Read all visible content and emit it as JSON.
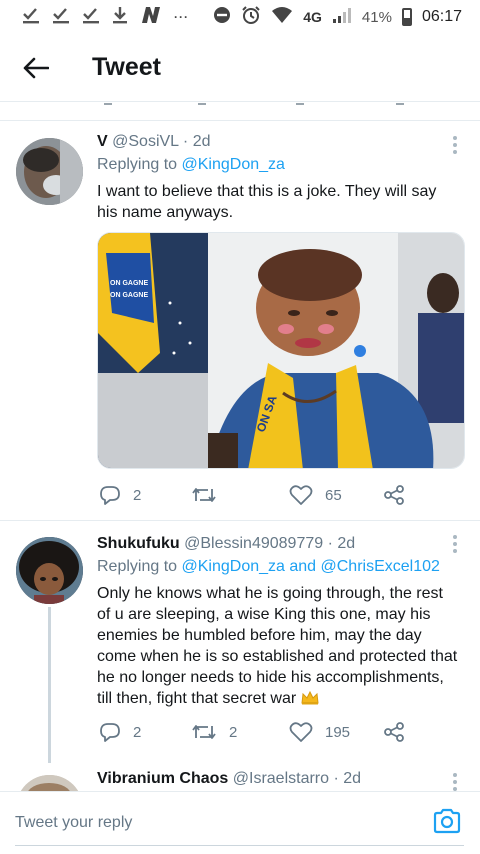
{
  "status_bar": {
    "network": "4G",
    "battery": "41%",
    "time": "06:17",
    "left_icons": [
      "check-download-icon",
      "check-download-icon",
      "check-download-icon",
      "download-icon",
      "n-app-icon",
      "ellipsis-icon"
    ],
    "right_icons": [
      "dnd-icon",
      "alarm-icon",
      "wifi-icon",
      "signal-icon",
      "battery-icon"
    ]
  },
  "header": {
    "title": "Tweet"
  },
  "tweets": [
    {
      "display_name": "V",
      "handle": "@SosiVL",
      "time": "· 2d",
      "replying_prefix": "Replying to",
      "replying_to": "@KingDon_za",
      "text": "I want to believe that this is a joke. They will say his name anyways.",
      "replies": "2",
      "retweets": "",
      "likes": "65",
      "media_text": [
        "ON GAGNE",
        "ON GAGNE",
        "ON SA"
      ]
    },
    {
      "display_name": "Shukufuku",
      "handle": "@Blessin49089779",
      "time": "· 2d",
      "replying_prefix": "Replying to",
      "replying_to": "@KingDon_za and @ChrisExcel102",
      "text": "Only he knows what he is going through, the rest of u are sleeping, a wise King this one, may his enemies be humbled before him, may the day come when he is so established and protected that he no longer needs to hide his accomplishments, till then, fight that secret war",
      "emoji": "crown-icon",
      "replies": "2",
      "retweets": "2",
      "likes": "195"
    },
    {
      "display_name": "Vibranium Chaos",
      "handle": "@Israelstarro",
      "time": "· 2d"
    }
  ],
  "reply_bar": {
    "placeholder": "Tweet your reply"
  },
  "colors": {
    "accent": "#1da1f2",
    "secondary_text": "#657786",
    "divider": "#e6ecf0"
  }
}
